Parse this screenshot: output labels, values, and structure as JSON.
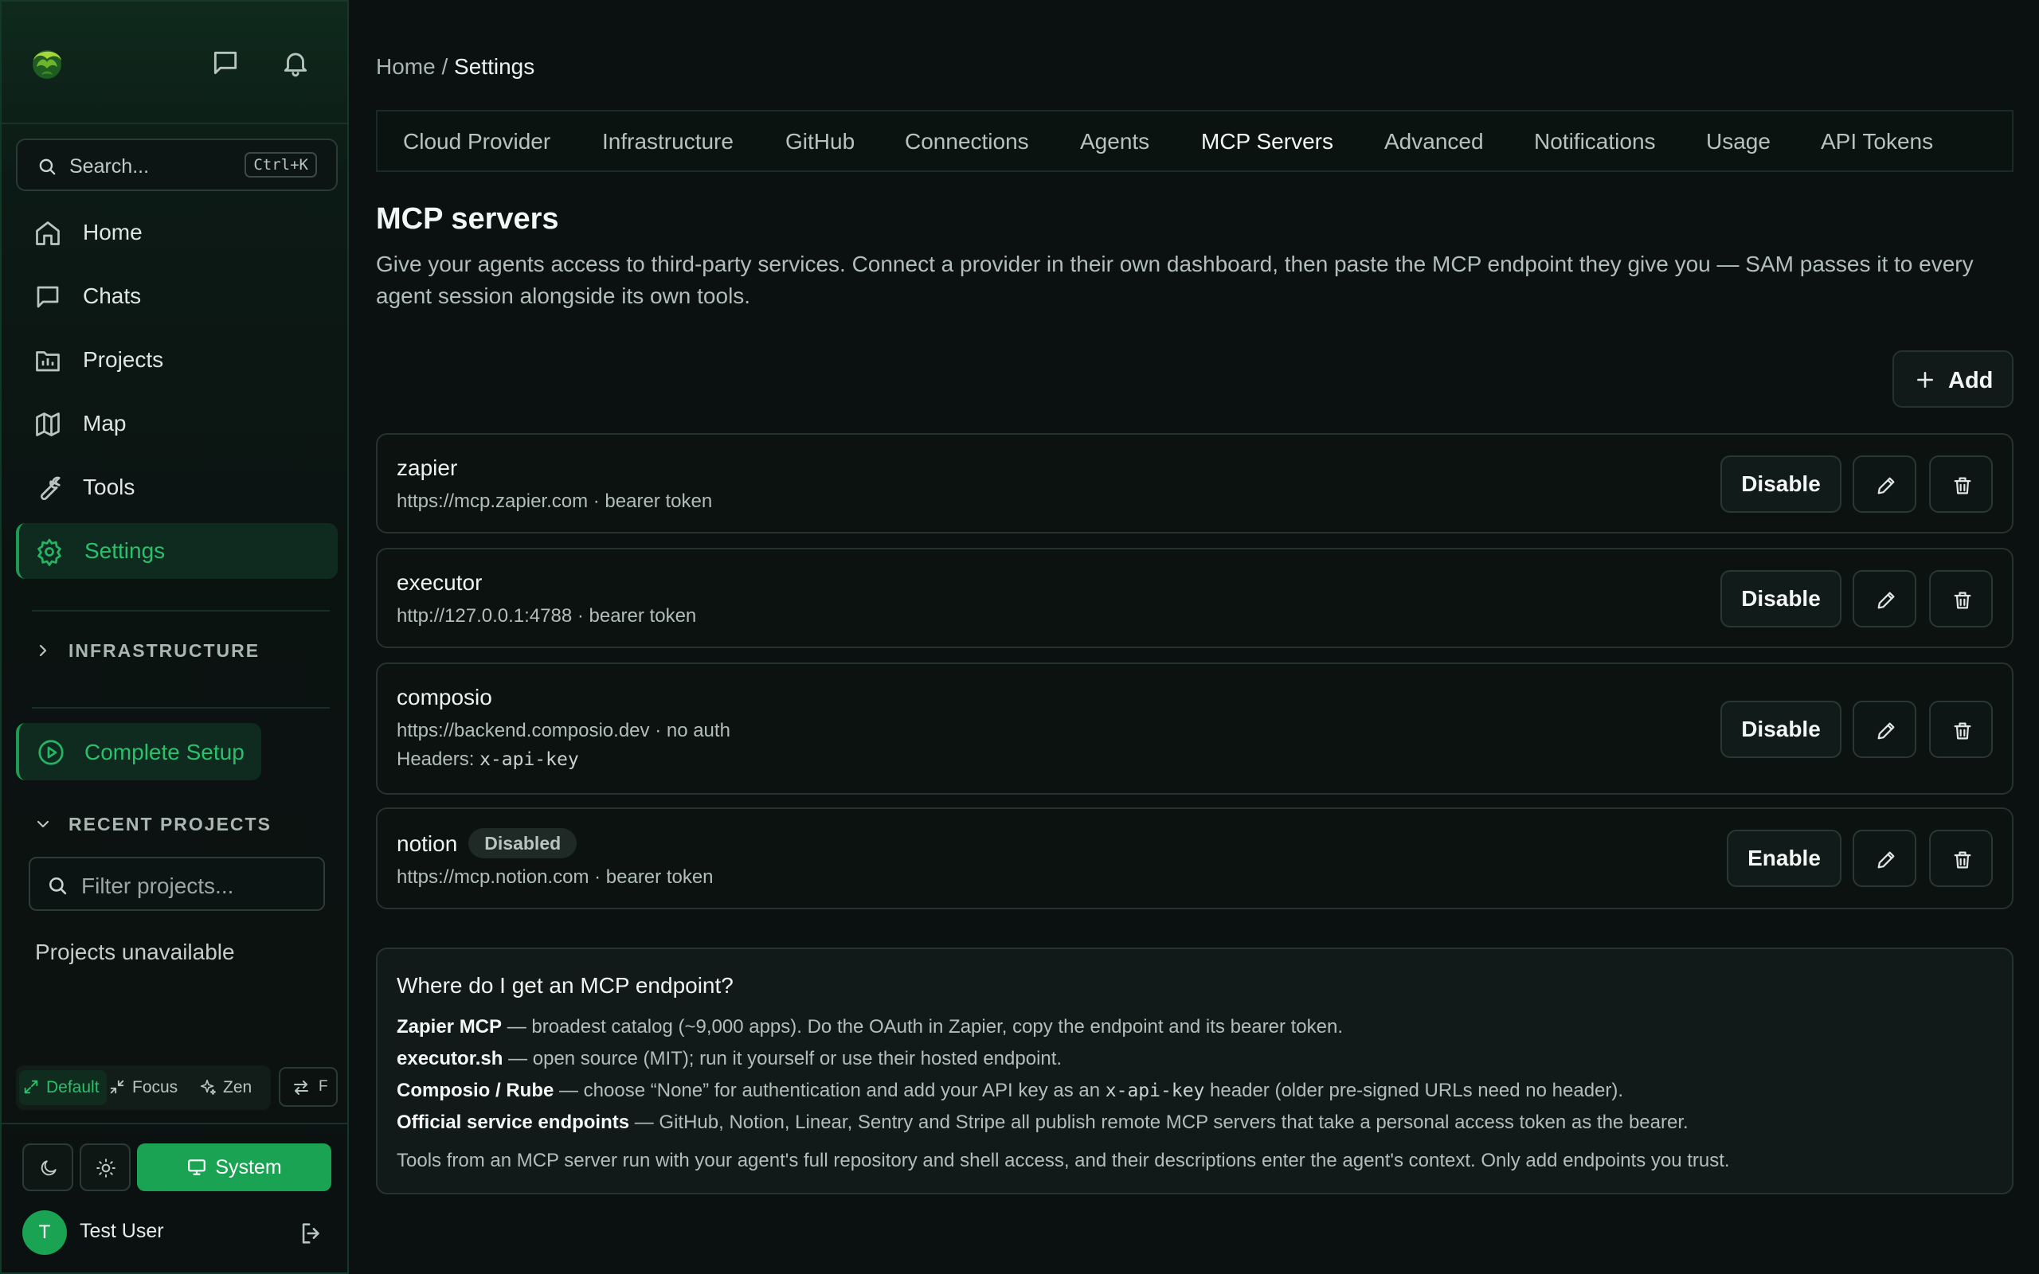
{
  "sidebar": {
    "search_placeholder": "Search...",
    "search_shortcut": "Ctrl+K",
    "nav": [
      {
        "label": "Home",
        "icon": "home-icon"
      },
      {
        "label": "Chats",
        "icon": "chat-icon"
      },
      {
        "label": "Projects",
        "icon": "folder-icon"
      },
      {
        "label": "Map",
        "icon": "map-icon"
      },
      {
        "label": "Tools",
        "icon": "wrench-icon"
      },
      {
        "label": "Settings",
        "icon": "gear-icon",
        "active": true
      }
    ],
    "infrastructure_heading": "INFRASTRUCTURE",
    "complete_setup_label": "Complete Setup",
    "recent_projects_heading": "RECENT PROJECTS",
    "filter_placeholder": "Filter projects...",
    "projects_unavailable": "Projects unavailable",
    "modes": [
      {
        "label": "Default",
        "active": true
      },
      {
        "label": "Focus"
      },
      {
        "label": "Zen"
      }
    ],
    "mode_swap_label": "F",
    "theme_system_label": "System",
    "user": {
      "initial": "T",
      "name": "Test User"
    }
  },
  "breadcrumb": {
    "home": "Home",
    "separator": " / ",
    "current": "Settings"
  },
  "tabs": [
    "Cloud Provider",
    "Infrastructure",
    "GitHub",
    "Connections",
    "Agents",
    "MCP Servers",
    "Advanced",
    "Notifications",
    "Usage",
    "API Tokens"
  ],
  "active_tab": "MCP Servers",
  "page": {
    "title": "MCP servers",
    "description": "Give your agents access to third-party services. Connect a provider in their own dashboard, then paste the MCP endpoint they give you — SAM passes it to every agent session alongside its own tools.",
    "add_label": "Add"
  },
  "servers": [
    {
      "name": "zapier",
      "details": "https://mcp.zapier.com · bearer token",
      "toggle": "Disable"
    },
    {
      "name": "executor",
      "details": "http://127.0.0.1:4788 · bearer token",
      "toggle": "Disable"
    },
    {
      "name": "composio",
      "details": "https://backend.composio.dev · no auth",
      "headers_label": "Headers: ",
      "headers_value": "x-api-key",
      "toggle": "Disable"
    },
    {
      "name": "notion",
      "badge": "Disabled",
      "details": "https://mcp.notion.com · bearer token",
      "toggle": "Enable"
    }
  ],
  "help": {
    "title": "Where do I get an MCP endpoint?",
    "items": [
      {
        "bold": "Zapier MCP",
        "text": " — broadest catalog (~9,000 apps). Do the OAuth in Zapier, copy the endpoint and its bearer token."
      },
      {
        "bold": "executor.sh",
        "text": " — open source (MIT); run it yourself or use their hosted endpoint."
      },
      {
        "bold": "Composio / Rube",
        "text_before": " — choose “None” for authentication and add your API key as an ",
        "code": "x-api-key",
        "text_after": " header (older pre-signed URLs need no header)."
      },
      {
        "bold": "Official service endpoints",
        "text": " — GitHub, Notion, Linear, Sentry and Stripe all publish remote MCP servers that take a personal access token as the bearer."
      }
    ],
    "note": "Tools from an MCP server run with your agent's full repository and shell access, and their descriptions enter the agent's context. Only add endpoints you trust."
  },
  "colors": {
    "accent": "#1aa352",
    "background": "#0b1110",
    "accent_text": "#2bc06b"
  }
}
